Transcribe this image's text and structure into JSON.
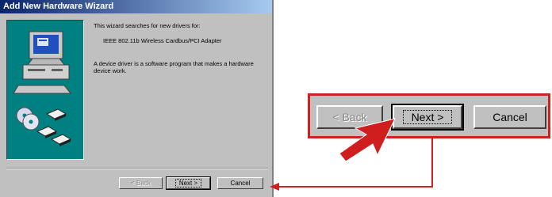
{
  "window": {
    "title": "Add New Hardware Wizard"
  },
  "content": {
    "intro": "This wizard searches for new drivers for:",
    "device": "IEEE 802.11b Wireless Cardbus/PCI Adapter",
    "description": "A device driver is a software program that makes a hardware device work."
  },
  "buttons": {
    "back": "< Back",
    "next": "Next >",
    "cancel": "Cancel"
  },
  "callout": {
    "back": "< Back",
    "next": "Next >",
    "cancel": "Cancel"
  },
  "colors": {
    "titlebar": "#0a246a",
    "panel": "#008080",
    "window": "#c0c0c0",
    "highlight": "#cc2222"
  }
}
